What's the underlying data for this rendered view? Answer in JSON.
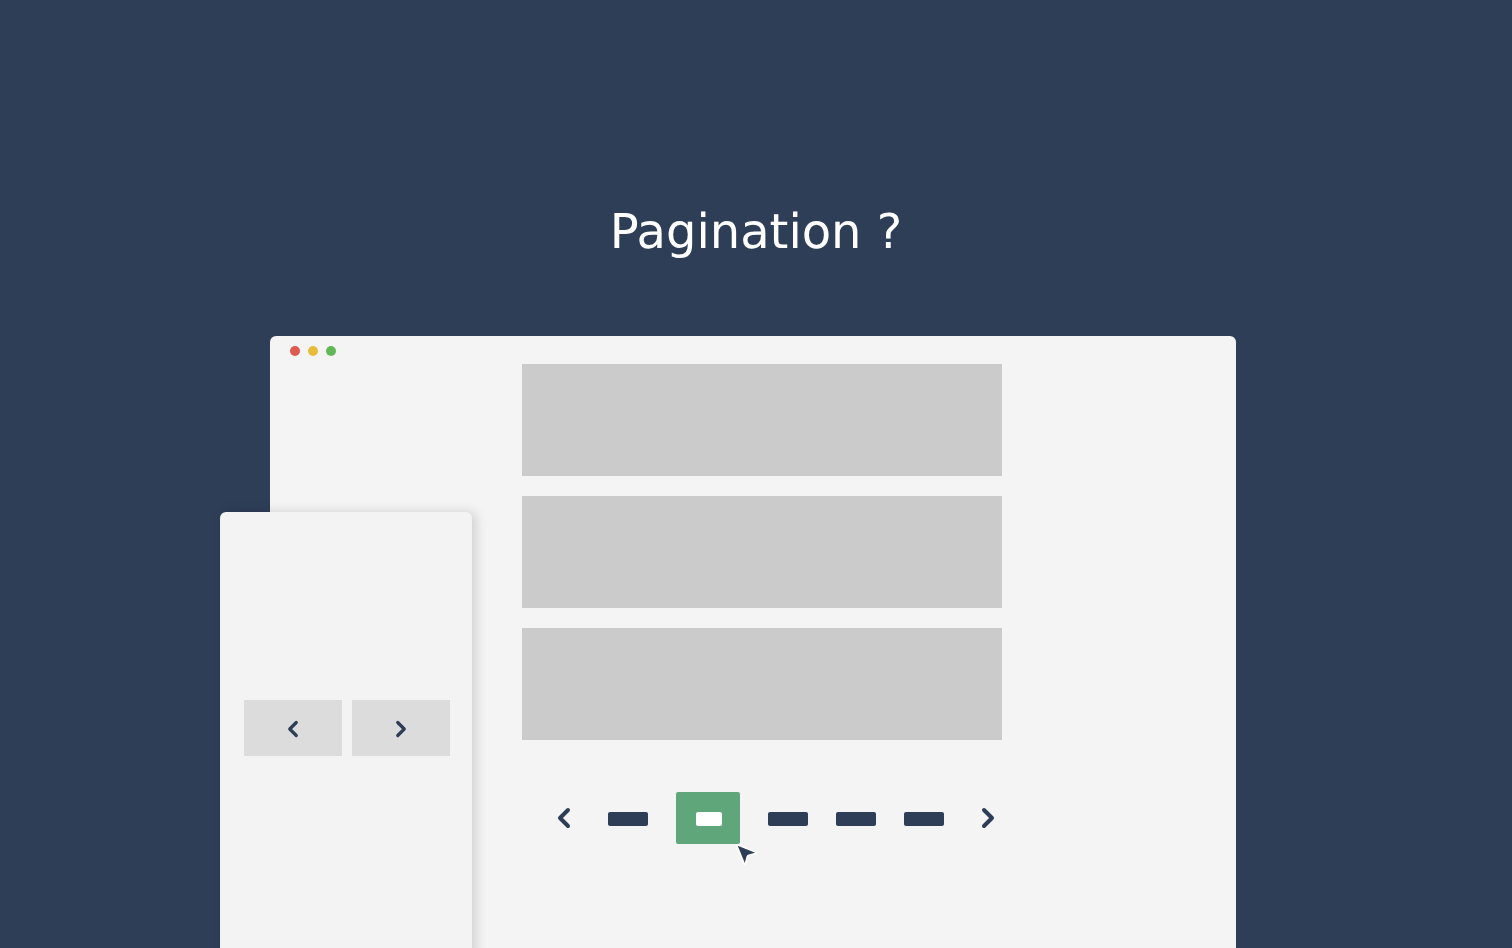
{
  "title": "Pagination ?",
  "pagination": {
    "pages": [
      {
        "selected": false
      },
      {
        "selected": true
      },
      {
        "selected": false
      },
      {
        "selected": false
      },
      {
        "selected": false
      }
    ]
  }
}
